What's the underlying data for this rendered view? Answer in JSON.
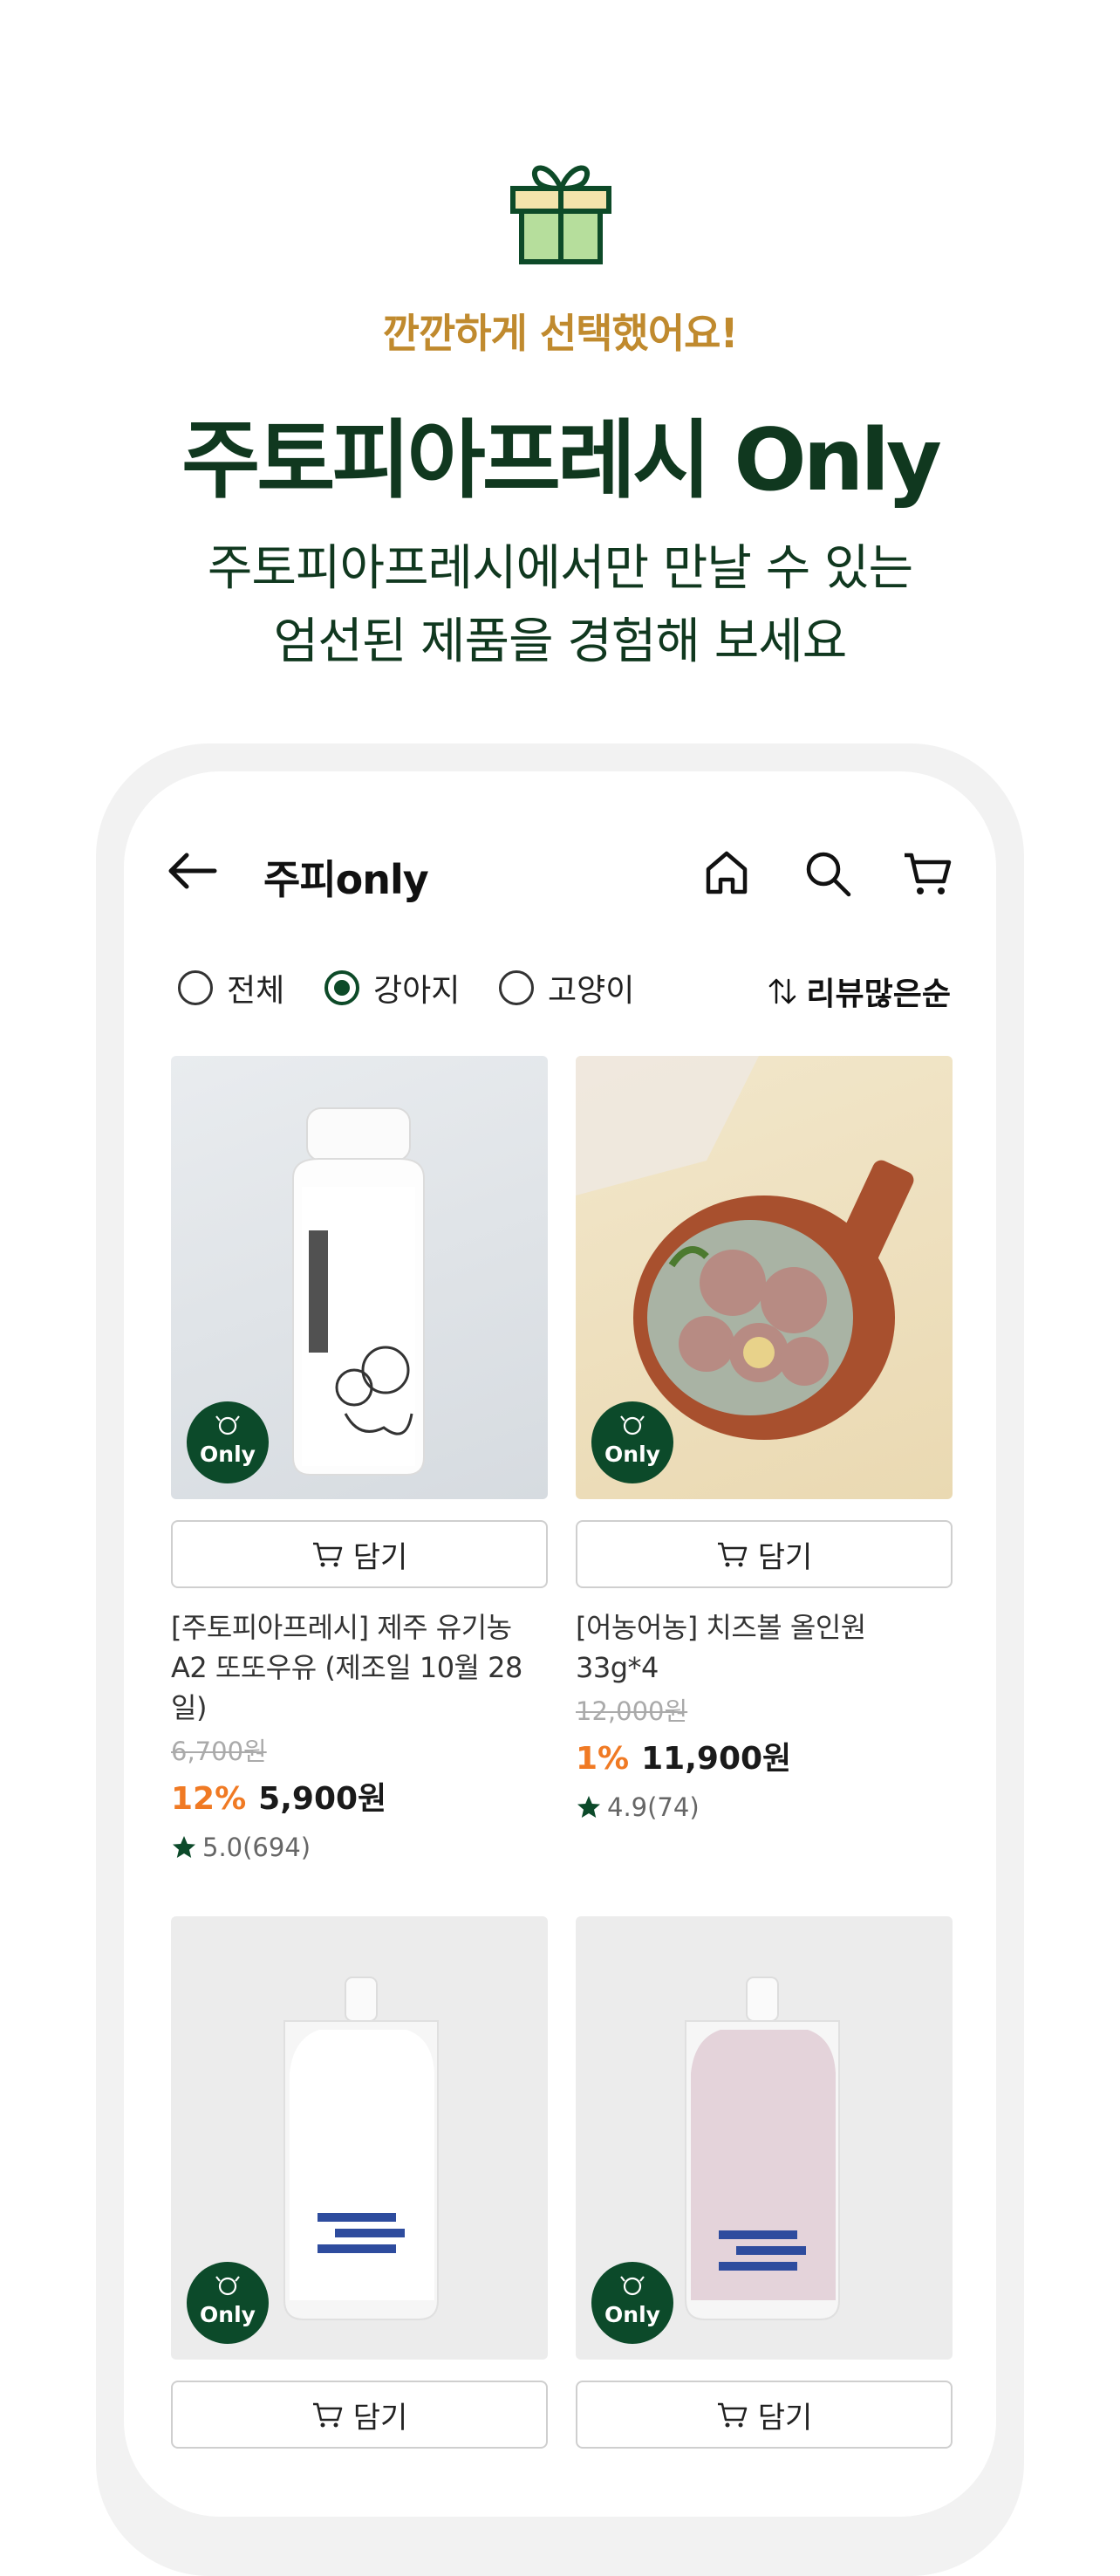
{
  "hero": {
    "eyebrow": "깐깐하게 선택했어요!",
    "headline": "주토피아프레시 Only",
    "sub_line1": "주토피아프레시에서만 만날 수 있는",
    "sub_line2": "엄선된 제품을 경험해 보세요"
  },
  "appbar": {
    "title": "주피only"
  },
  "filters": {
    "options": [
      "전체",
      "강아지",
      "고양이"
    ],
    "selected": "강아지",
    "sort_label": "리뷰많은순"
  },
  "badge_label": "Only",
  "add_label": "담기",
  "products": [
    {
      "name": "[주토피아프레시] 제주 유기농 A2 또또우유 (제조일 10월 28일)",
      "original_price": "6,700원",
      "discount": "12%",
      "price": "5,900원",
      "rating": "5.0(694)"
    },
    {
      "name": "[어농어농] 치즈볼 올인원 33g*4",
      "original_price": "12,000원",
      "discount": "1%",
      "price": "11,900원",
      "rating": "4.9(74)"
    },
    {
      "name": "",
      "original_price": "",
      "discount": "",
      "price": "",
      "rating": ""
    },
    {
      "name": "",
      "original_price": "",
      "discount": "",
      "price": "",
      "rating": ""
    }
  ],
  "colors": {
    "brand_green": "#10381f",
    "accent_gold": "#c08a2e",
    "discount_orange": "#f07a24"
  }
}
